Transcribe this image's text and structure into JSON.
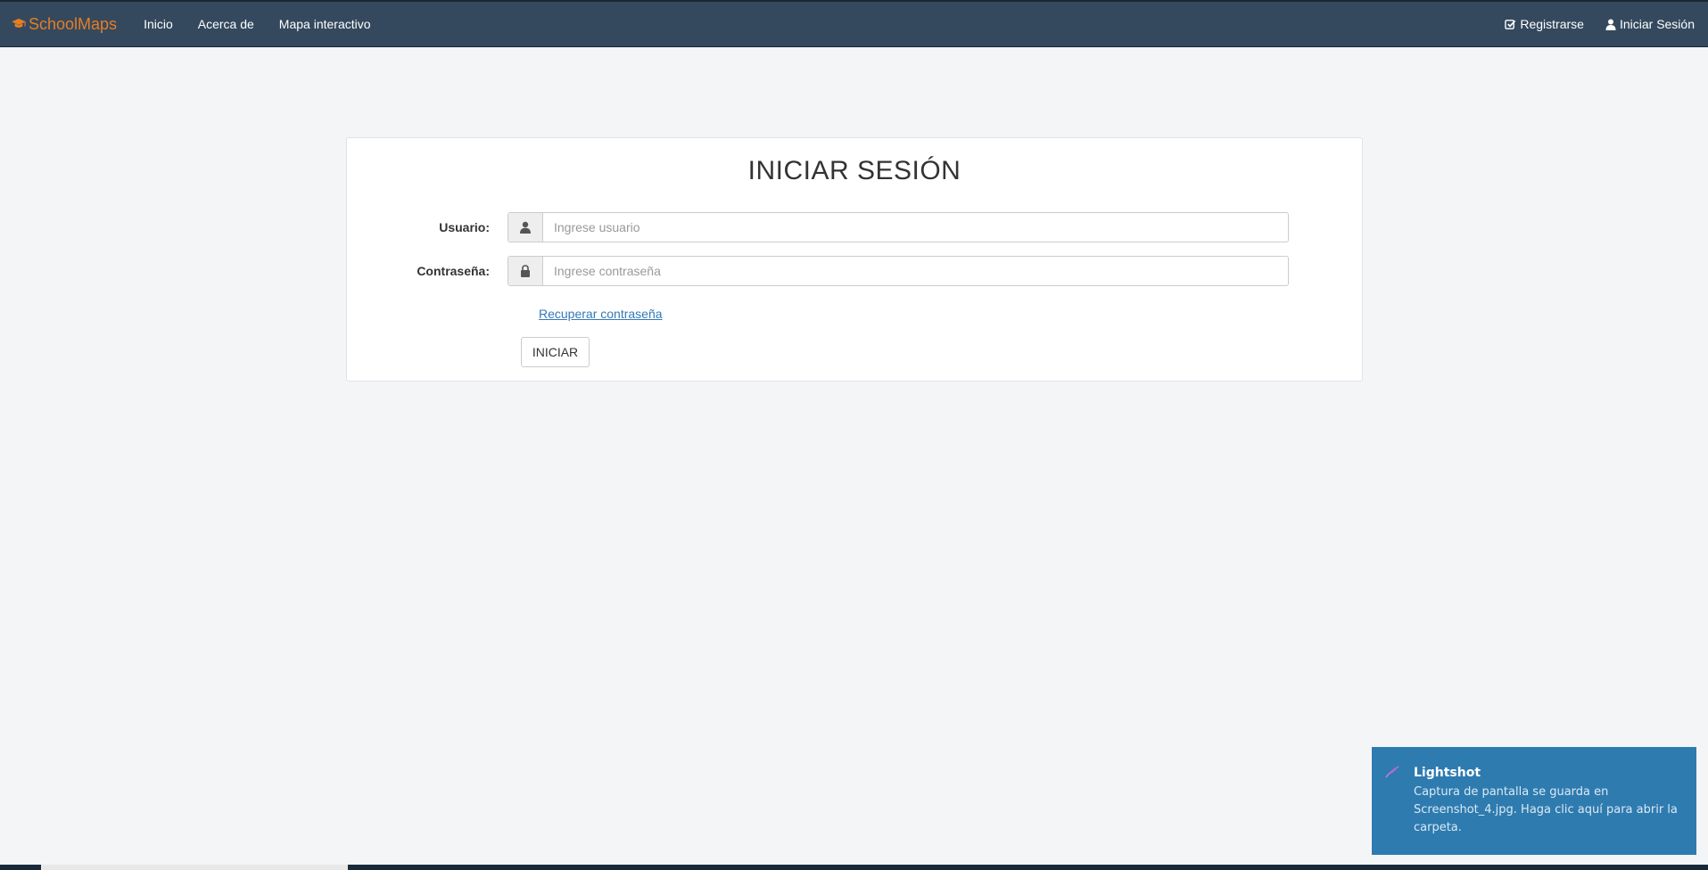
{
  "navbar": {
    "brand": "SchoolMaps",
    "brand_color": "#e67e22",
    "background": "#34495e",
    "links": [
      {
        "label": "Inicio"
      },
      {
        "label": "Acerca de"
      },
      {
        "label": "Mapa interactivo"
      }
    ],
    "right_links": [
      {
        "label": "Registrarse",
        "icon": "check-square-icon"
      },
      {
        "label": "Iniciar Sesión",
        "icon": "user-icon"
      }
    ]
  },
  "login": {
    "title": "INICIAR SESIÓN",
    "username": {
      "label": "Usuario:",
      "placeholder": "Ingrese usuario",
      "value": "",
      "icon": "user-icon"
    },
    "password": {
      "label": "Contraseña:",
      "placeholder": "Ingrese contraseña",
      "value": "",
      "icon": "lock-icon"
    },
    "recover_link": "Recuperar contraseña",
    "submit_label": "INICIAR"
  },
  "toast": {
    "title": "Lightshot",
    "message": "Captura de pantalla se guarda en Screenshot_4.jpg. Haga clic aquí para abrir la carpeta.",
    "background": "#2e7bb0",
    "icon": "feather-icon"
  }
}
